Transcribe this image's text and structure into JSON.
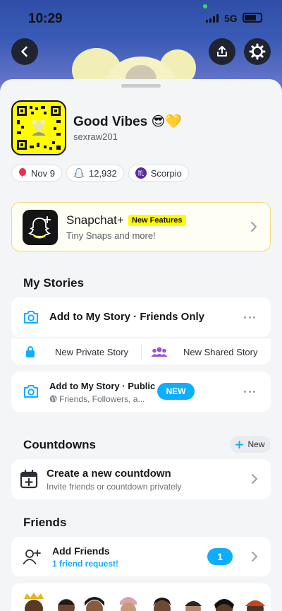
{
  "status_bar": {
    "time": "10:29",
    "network": "5G"
  },
  "profile": {
    "display_name": "Good Vibes 😎💛",
    "username": "sexraw201",
    "chips": [
      {
        "icon": "balloon-icon",
        "label": "Nov 9"
      },
      {
        "icon": "snap-ghost-icon",
        "label": "12,932"
      },
      {
        "icon": "scorpio-icon",
        "label": "Scorpio"
      }
    ]
  },
  "snapchat_plus": {
    "title": "Snapchat+",
    "badge": "New Features",
    "subtitle": "Tiny Snaps and more!"
  },
  "my_stories": {
    "heading": "My Stories",
    "add_friends_only": "Add to My Story · Friends Only",
    "new_private": "New Private Story",
    "new_shared": "New Shared Story",
    "add_public": "Add to My Story · Public",
    "public_sub": "Friends, Followers, a...",
    "public_badge": "NEW"
  },
  "countdowns": {
    "heading": "Countdowns",
    "new_button": "New",
    "create_title": "Create a new countdown",
    "create_sub": "Invite friends or countdown privately"
  },
  "friends": {
    "heading": "Friends",
    "add_title": "Add Friends",
    "add_sub": "1 friend request!",
    "count": "1"
  },
  "colors": {
    "accent": "#0fadff",
    "snap_yellow": "#fffc00",
    "background": "#f4f5f7"
  }
}
